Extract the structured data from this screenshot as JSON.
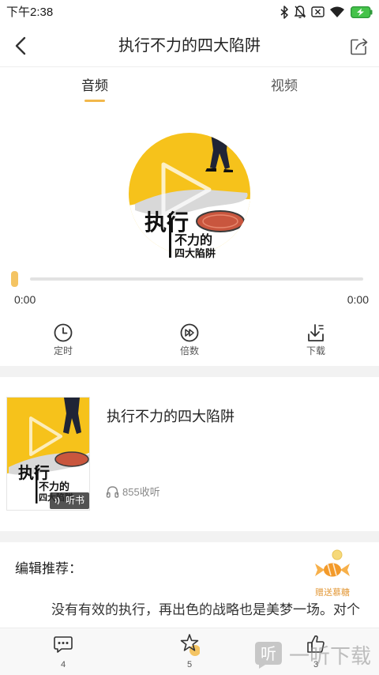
{
  "status_bar": {
    "time": "下午2:38",
    "icons": [
      "bluetooth-icon",
      "mute-icon",
      "no-sim-icon",
      "wifi-icon",
      "battery-charging-icon"
    ]
  },
  "header": {
    "title": "执行不力的四大陷阱",
    "back_icon": "back-arrow-icon",
    "share_icon": "share-icon"
  },
  "tabs": [
    {
      "label": "音频",
      "active": true
    },
    {
      "label": "视频",
      "active": false
    }
  ],
  "cover": {
    "line1": "执行",
    "line2": "不力的",
    "line3": "四大陷阱"
  },
  "player": {
    "progress": 0,
    "current_time": "0:00",
    "total_time": "0:00"
  },
  "controls": [
    {
      "label": "定时",
      "icon": "clock-icon"
    },
    {
      "label": "倍数",
      "icon": "speed-icon"
    },
    {
      "label": "下载",
      "icon": "download-icon"
    }
  ],
  "book": {
    "title": "执行不力的四大陷阱",
    "badge": "听书",
    "listens": "855收听"
  },
  "recommend": {
    "heading": "编辑推荐：",
    "gift_label": "赠送慕糖",
    "description": "没有有效的执行，再出色的战略也是美梦一场。对个"
  },
  "bottom_bar": {
    "comments": "4",
    "favorites": "5",
    "likes": "3"
  },
  "watermark": {
    "logo": "听",
    "text": "一听下载"
  },
  "colors": {
    "accent": "#f2b84b",
    "cover_yellow": "#f6c21b",
    "gift_orange": "#e39a3b",
    "battery_green": "#45c34a",
    "divider": "#f2f2f2"
  }
}
